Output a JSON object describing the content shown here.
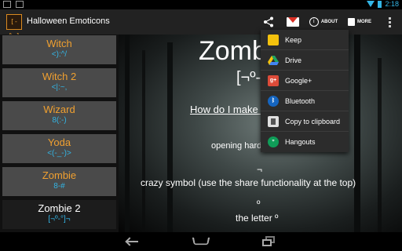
{
  "status_bar": {
    "time": "2:18"
  },
  "action_bar": {
    "icon_text": "[-°-]",
    "title": "Halloween Emoticons",
    "about_label": "ABOUT",
    "more_label": "MORE",
    "icons": [
      "share-icon",
      "gmail-icon",
      "info-icon",
      "shopping-bag-icon",
      "overflow-menu-icon"
    ]
  },
  "emoticons": [
    {
      "name": "Witch",
      "emoticon": "<):^/"
    },
    {
      "name": "Witch 2",
      "emoticon": "<|:~,"
    },
    {
      "name": "Wizard",
      "emoticon": "8(:-)"
    },
    {
      "name": "Yoda",
      "emoticon": "<(-_-)>"
    },
    {
      "name": "Zombie",
      "emoticon": "8-#"
    },
    {
      "name": "Zombie 2",
      "emoticon": "[¬º-°]¬",
      "selected": true
    }
  ],
  "detail": {
    "title": "Zombie 2",
    "emoticon": "[¬º-°]¬",
    "how_link": "How do I make this?",
    "line1": "opening hard bracket [",
    "symbol1": "¬",
    "line2": "crazy symbol (use the share functionality at the top)",
    "symbol2": "º",
    "line3": "the letter º"
  },
  "share_menu": [
    {
      "label": "Keep",
      "icon": "keep-icon",
      "color": "#f4c20d"
    },
    {
      "label": "Drive",
      "icon": "drive-icon",
      "color": "#1fa463"
    },
    {
      "label": "Google+",
      "icon": "google-plus-icon",
      "color": "#dd4b39"
    },
    {
      "label": "Bluetooth",
      "icon": "bluetooth-icon",
      "color": "#1565c0"
    },
    {
      "label": "Copy to clipboard",
      "icon": "clipboard-icon",
      "color": "#555555"
    },
    {
      "label": "Hangouts",
      "icon": "hangouts-icon",
      "color": "#0f9d58"
    }
  ],
  "colors": {
    "accent_orange": "#f0a030",
    "accent_blue": "#33b5e5"
  }
}
